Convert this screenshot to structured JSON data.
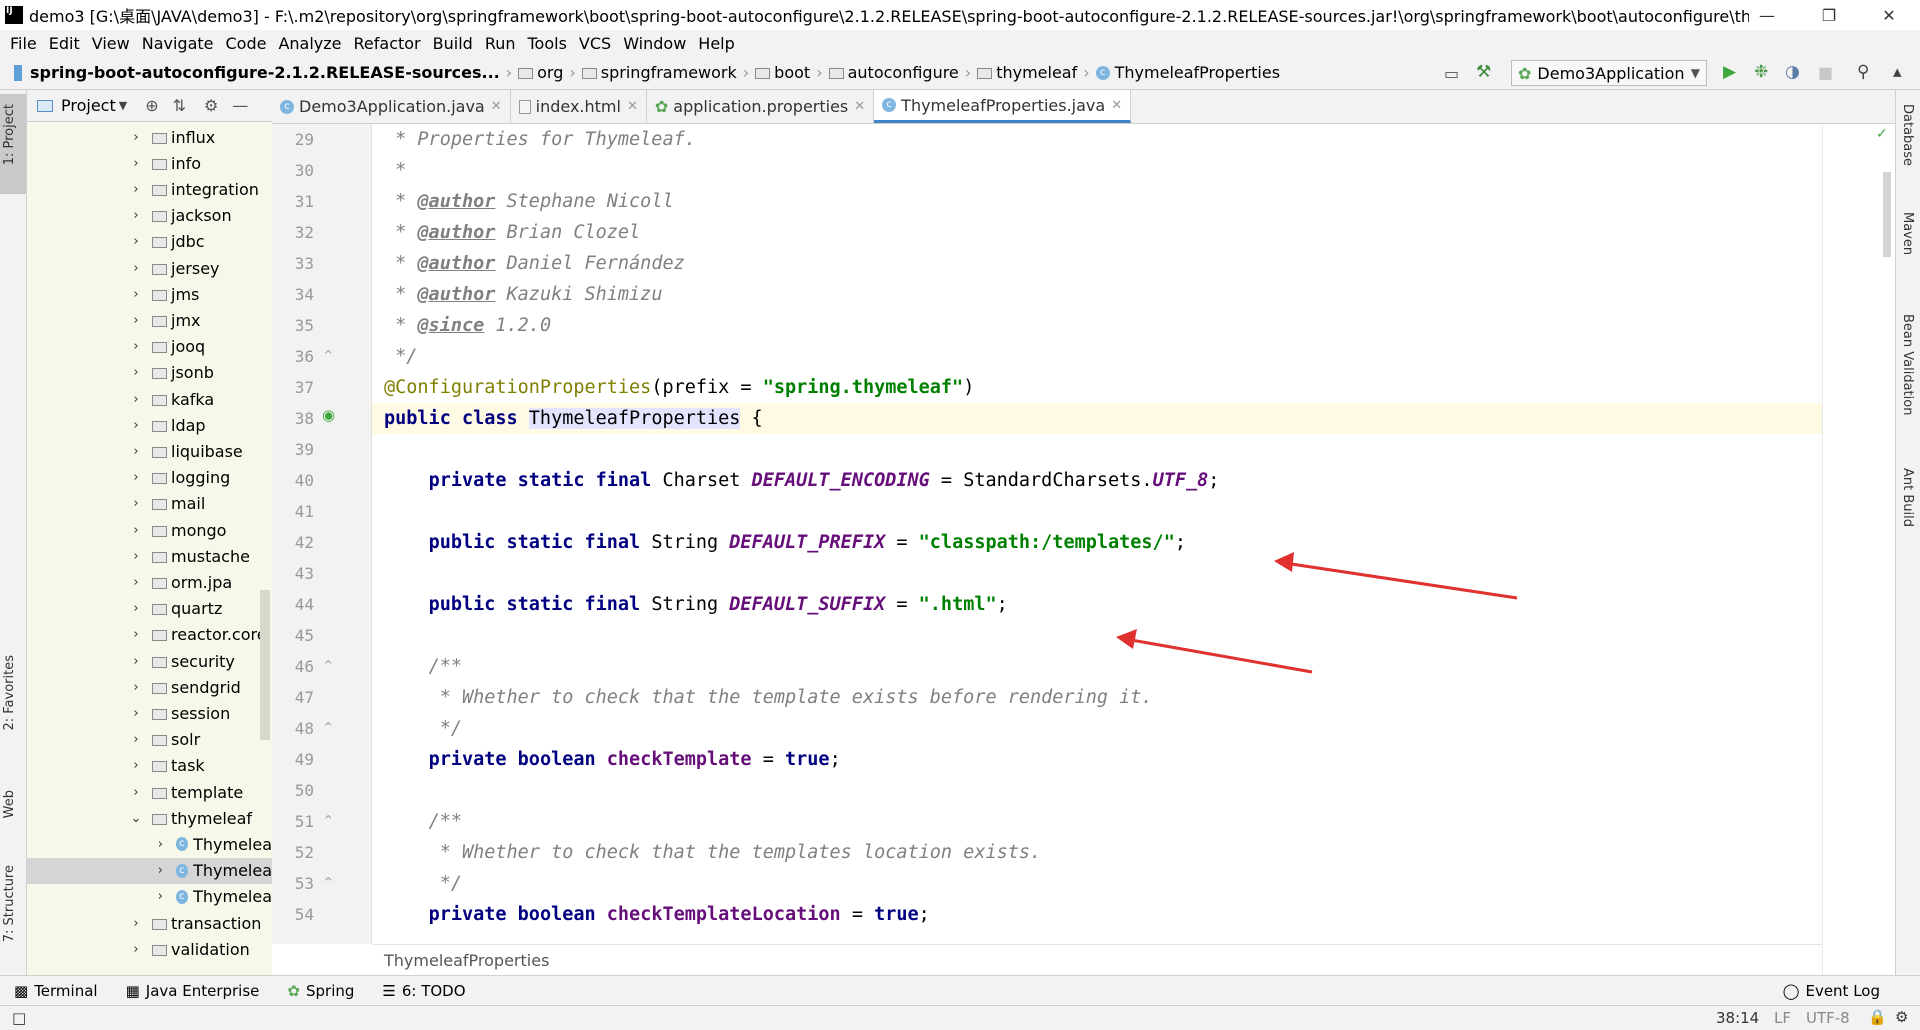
{
  "window": {
    "title": "demo3 [G:\\桌面\\JAVA\\demo3] - F:\\.m2\\repository\\org\\springframework\\boot\\spring-boot-autoconfigure\\2.1.2.RELEASE\\spring-boot-autoconfigure-2.1.2.RELEASE-sources.jar!\\org\\springframework\\boot\\autoconfigure\\thymeleaf\\Thy..."
  },
  "menu": [
    "File",
    "Edit",
    "View",
    "Navigate",
    "Code",
    "Analyze",
    "Refactor",
    "Build",
    "Run",
    "Tools",
    "VCS",
    "Window",
    "Help"
  ],
  "breadcrumb": [
    "spring-boot-autoconfigure-2.1.2.RELEASE-sources...",
    "org",
    "springframework",
    "boot",
    "autoconfigure",
    "thymeleaf",
    "ThymeleafProperties"
  ],
  "run_config": "Demo3Application",
  "left_tabs": [
    "1: Project",
    "2: Favorites",
    "Web",
    "7: Structure"
  ],
  "right_tabs": [
    "Database",
    "Maven",
    "Bean Validation",
    "Ant Build"
  ],
  "project_panel": {
    "title": "Project",
    "items": [
      {
        "label": "influx",
        "kind": "folder",
        "expanded": false
      },
      {
        "label": "info",
        "kind": "folder",
        "expanded": false
      },
      {
        "label": "integration",
        "kind": "folder",
        "expanded": false
      },
      {
        "label": "jackson",
        "kind": "folder",
        "expanded": false
      },
      {
        "label": "jdbc",
        "kind": "folder",
        "expanded": false
      },
      {
        "label": "jersey",
        "kind": "folder",
        "expanded": false
      },
      {
        "label": "jms",
        "kind": "folder",
        "expanded": false
      },
      {
        "label": "jmx",
        "kind": "folder",
        "expanded": false
      },
      {
        "label": "jooq",
        "kind": "folder",
        "expanded": false
      },
      {
        "label": "jsonb",
        "kind": "folder",
        "expanded": false
      },
      {
        "label": "kafka",
        "kind": "folder",
        "expanded": false
      },
      {
        "label": "ldap",
        "kind": "folder",
        "expanded": false
      },
      {
        "label": "liquibase",
        "kind": "folder",
        "expanded": false
      },
      {
        "label": "logging",
        "kind": "folder",
        "expanded": false
      },
      {
        "label": "mail",
        "kind": "folder",
        "expanded": false
      },
      {
        "label": "mongo",
        "kind": "folder",
        "expanded": false
      },
      {
        "label": "mustache",
        "kind": "folder",
        "expanded": false
      },
      {
        "label": "orm.jpa",
        "kind": "folder",
        "expanded": false
      },
      {
        "label": "quartz",
        "kind": "folder",
        "expanded": false
      },
      {
        "label": "reactor.core",
        "kind": "folder",
        "expanded": false
      },
      {
        "label": "security",
        "kind": "folder",
        "expanded": false
      },
      {
        "label": "sendgrid",
        "kind": "folder",
        "expanded": false
      },
      {
        "label": "session",
        "kind": "folder",
        "expanded": false
      },
      {
        "label": "solr",
        "kind": "folder",
        "expanded": false
      },
      {
        "label": "task",
        "kind": "folder",
        "expanded": false
      },
      {
        "label": "template",
        "kind": "folder",
        "expanded": false
      },
      {
        "label": "thymeleaf",
        "kind": "folder",
        "expanded": true
      },
      {
        "label": "Thymelea",
        "kind": "class",
        "expanded": false
      },
      {
        "label": "Thymelea",
        "kind": "class",
        "expanded": false,
        "selected": true
      },
      {
        "label": "Thymelea",
        "kind": "class",
        "expanded": false
      },
      {
        "label": "transaction",
        "kind": "folder",
        "expanded": false
      },
      {
        "label": "validation",
        "kind": "folder",
        "expanded": false
      }
    ]
  },
  "tabs": [
    {
      "label": "Demo3Application.java",
      "active": false
    },
    {
      "label": "index.html",
      "active": false
    },
    {
      "label": "application.properties",
      "active": false
    },
    {
      "label": "ThymeleafProperties.java",
      "active": true
    }
  ],
  "editor": {
    "line_numbers": [
      "29",
      "30",
      "31",
      "32",
      "33",
      "34",
      "35",
      "36",
      "37",
      "38",
      "39",
      "40",
      "41",
      "42",
      "43",
      "44",
      "45",
      "46",
      "47",
      "48",
      "49",
      "50",
      "51",
      "52",
      "53",
      "54"
    ],
    "lines": {
      "l29": " * Properties for Thymeleaf.",
      "l30": " *",
      "l31_tag": "@author",
      "l31_text": " Stephane Nicoll",
      "l32_tag": "@author",
      "l32_text": " Brian Clozel",
      "l33_tag": "@author",
      "l33_text": " Daniel Fernández",
      "l34_tag": "@author",
      "l34_text": " Kazuki Shimizu",
      "l35_tag": "@since",
      "l35_text": " 1.2.0",
      "l36": " */",
      "l37_ann": "@ConfigurationProperties",
      "l37_mid": "(prefix = ",
      "l37_str": "\"spring.thymeleaf\"",
      "l37_end": ")",
      "l38_kw": "public class ",
      "l38_cls": "ThymeleafProperties",
      "l38_end": " {",
      "l40_kw": "private static final ",
      "l40_type": "Charset ",
      "l40_fld": "DEFAULT_ENCODING",
      "l40_mid": " = StandardCharsets.",
      "l40_fld2": "UTF_8",
      "l40_end": ";",
      "l42_kw": "public static final ",
      "l42_type": "String ",
      "l42_fld": "DEFAULT_PREFIX",
      "l42_mid": " = ",
      "l42_str": "\"classpath:/templates/\"",
      "l42_end": ";",
      "l44_kw": "public static final ",
      "l44_type": "String ",
      "l44_fld": "DEFAULT_SUFFIX",
      "l44_mid": " = ",
      "l44_str": "\".html\"",
      "l44_end": ";",
      "l46": "/**",
      "l47": " * Whether to check that the template exists before rendering it.",
      "l48": " */",
      "l49_kw": "private boolean ",
      "l49_fld": "checkTemplate",
      "l49_mid": " = ",
      "l49_val": "true",
      "l49_end": ";",
      "l51": "/**",
      "l52": " * Whether to check that the templates location exists.",
      "l53": " */",
      "l54_kw": "private boolean ",
      "l54_fld": "checkTemplateLocation",
      "l54_mid": " = ",
      "l54_val": "true",
      "l54_end": ";"
    },
    "bottom_breadcrumb": "ThymeleafProperties"
  },
  "bottom_tools": [
    "Terminal",
    "Java Enterprise",
    "Spring",
    "6: TODO",
    "Event Log"
  ],
  "status": {
    "position": "38:14",
    "line_sep": "LF",
    "encoding": "UTF-8"
  },
  "colors": {
    "keyword": "#000080",
    "string": "#008000",
    "annotation": "#808000",
    "field": "#660e7a",
    "comment": "#808080",
    "arrow": "#e03030"
  }
}
